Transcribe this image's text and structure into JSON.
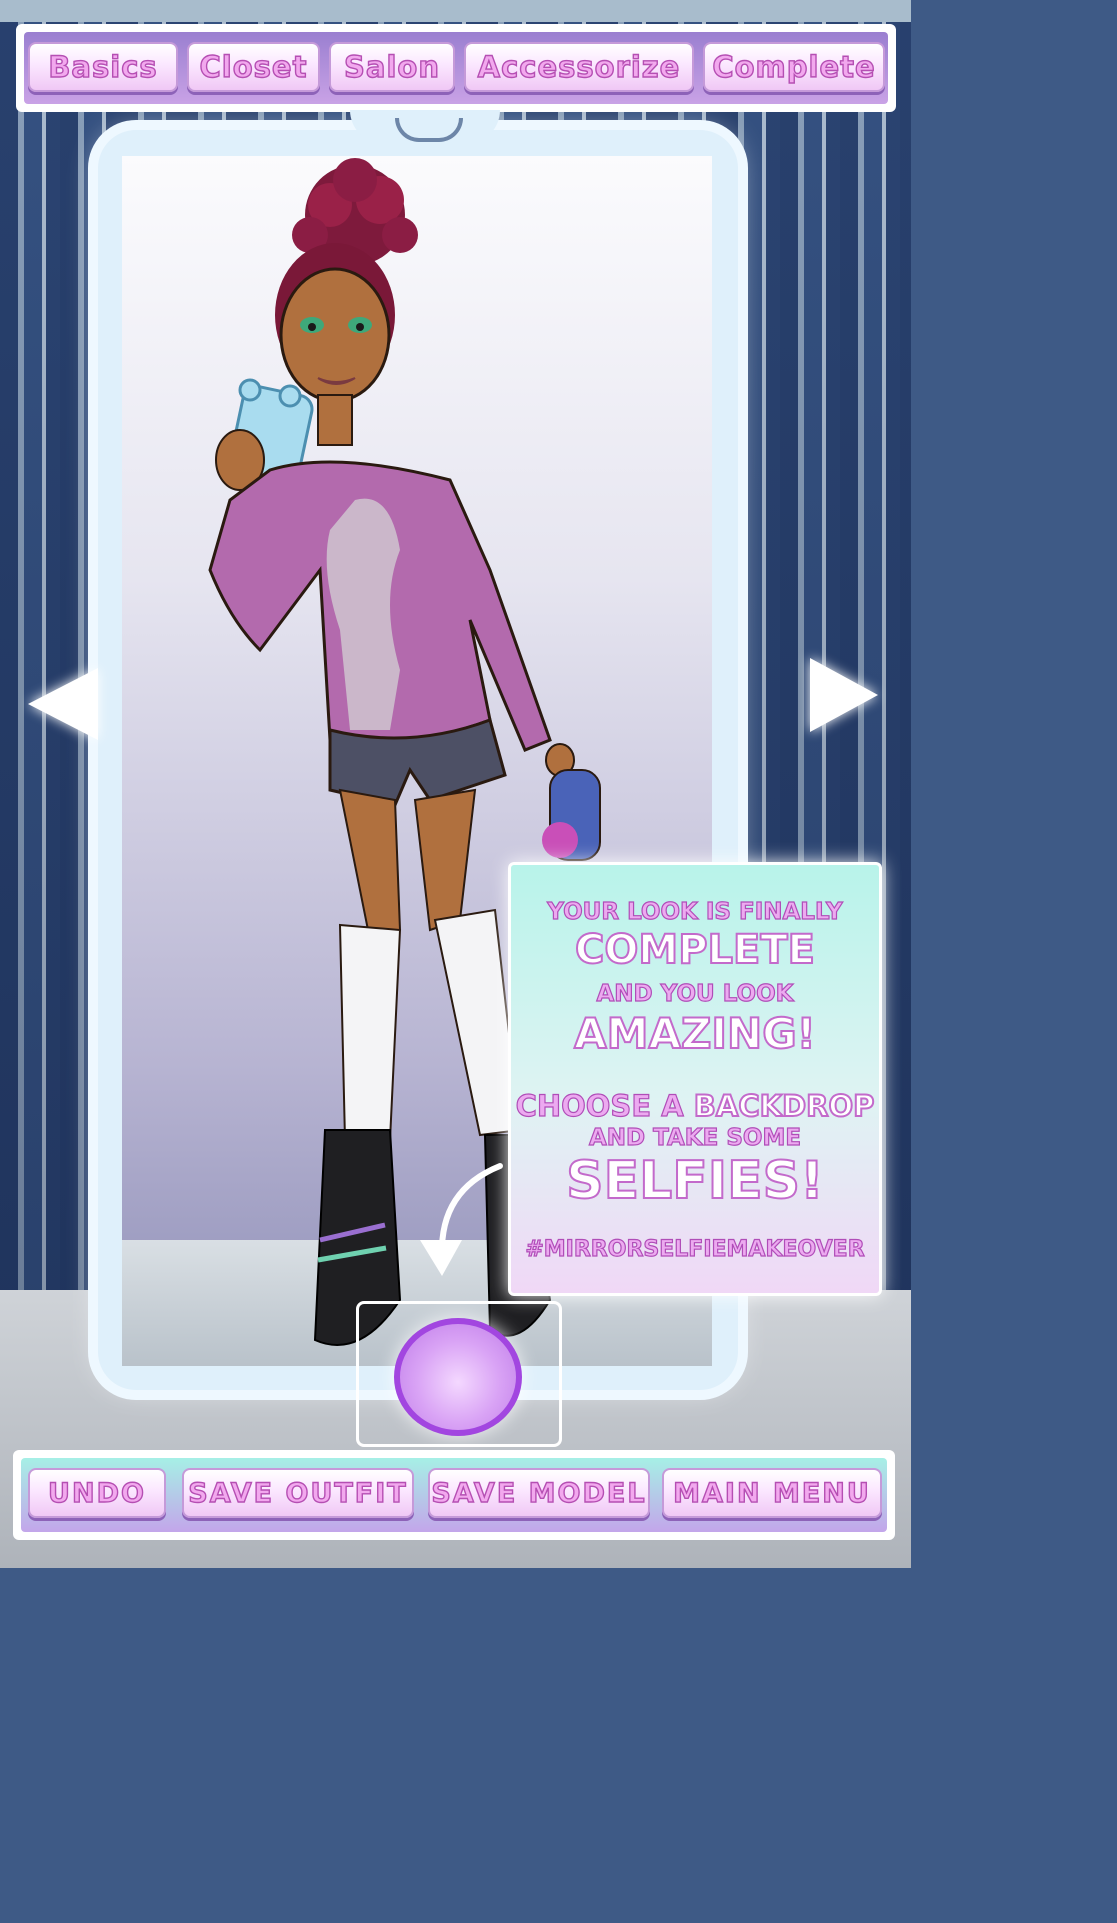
{
  "top_nav": {
    "tabs": [
      {
        "label": "Basics"
      },
      {
        "label": "Closet"
      },
      {
        "label": "Salon"
      },
      {
        "label": "Accessorize"
      },
      {
        "label": "Complete"
      }
    ]
  },
  "message": {
    "line1": "YOUR LOOK IS FINALLY",
    "line2": "COMPLETE",
    "line3": "AND YOU LOOK",
    "line4": "AMAZING!",
    "line5a": "CHOOSE A",
    "line5b": "BACKDROP",
    "line6": "AND TAKE SOME",
    "line7": "SELFIES!",
    "hashtag": "#MIRRORSELFIEMAKEOVER"
  },
  "bottom_nav": {
    "undo": "UNDO",
    "save_outfit": "SAVE OUTFIT",
    "save_model": "SAVE MODEL",
    "main_menu": "MAIN MENU"
  },
  "icons": {
    "prev_backdrop": "left-triangle-arrow-icon",
    "next_backdrop": "right-triangle-arrow-icon",
    "camera": "camera-shutter-button",
    "hint": "curved-arrow-icon"
  },
  "colors": {
    "button_text": "#f2a8ee",
    "button_outline": "#b54fb3",
    "shutter": "#a246e0",
    "curtain": "#2c4675"
  }
}
